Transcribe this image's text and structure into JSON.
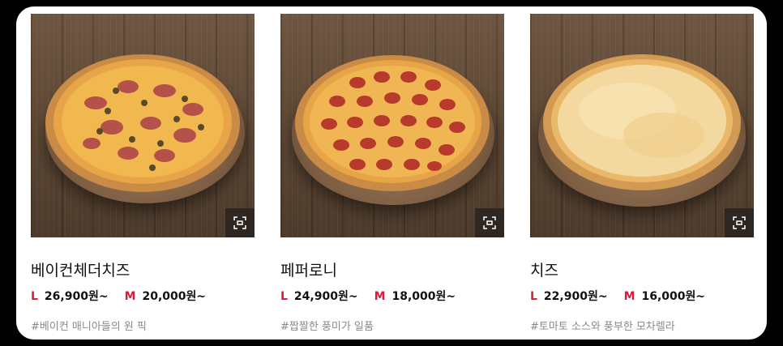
{
  "products": [
    {
      "name": "베이컨체더치즈",
      "sizes": [
        {
          "size": "L",
          "price": "26,900원~"
        },
        {
          "size": "M",
          "price": "20,000원~"
        }
      ],
      "tag": "#베이컨 매니아들의 원 픽",
      "image_desc": "bacon-cheddar-cheese-pizza"
    },
    {
      "name": "페퍼로니",
      "sizes": [
        {
          "size": "L",
          "price": "24,900원~"
        },
        {
          "size": "M",
          "price": "18,000원~"
        }
      ],
      "tag": "#짭짤한 풍미가 일품",
      "image_desc": "pepperoni-pizza"
    },
    {
      "name": "치즈",
      "sizes": [
        {
          "size": "L",
          "price": "22,900원~"
        },
        {
          "size": "M",
          "price": "16,000원~"
        }
      ],
      "tag": "#토마토 소스와 풍부한 모차렐라",
      "image_desc": "cheese-pizza"
    }
  ],
  "icons": {
    "zoom": "expand-icon"
  },
  "colors": {
    "size_label": "#e31837",
    "title": "#111111",
    "tag": "#8a8a8a",
    "panel_bg": "#ffffff",
    "page_bg": "#000000"
  }
}
